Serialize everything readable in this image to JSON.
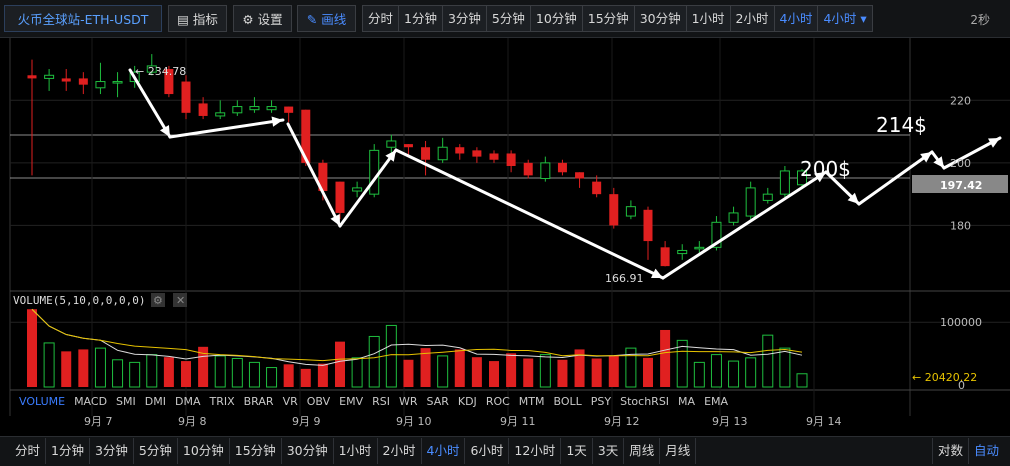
{
  "toolbar": {
    "symbol": "火币全球站-ETH-USDT",
    "indicators_label": "指标",
    "settings_label": "设置",
    "draw_label": "画线",
    "periods": [
      "分时",
      "1分钟",
      "3分钟",
      "5分钟",
      "10分钟",
      "15分钟",
      "30分钟",
      "1小时",
      "2小时",
      "4小时",
      "4小时"
    ],
    "active_period": 9,
    "refresh": "2秒"
  },
  "price_axis": {
    "ticks": [
      "220",
      "200",
      "180"
    ],
    "current_price": "197.42",
    "high_label": "← 234.78",
    "low_label": "166.91"
  },
  "annotations": {
    "label_200": "200$",
    "label_214": "214$"
  },
  "volume": {
    "title": "VOLUME(5,10,0,0,0,0)",
    "axis_tick": "100000",
    "axis_zero": "0",
    "current": "← 20420.22"
  },
  "indicator_tabs": [
    "VOLUME",
    "MACD",
    "SMI",
    "DMI",
    "DMA",
    "TRIX",
    "BRAR",
    "VR",
    "OBV",
    "EMV",
    "RSI",
    "WR",
    "SAR",
    "KDJ",
    "ROC",
    "MTM",
    "BOLL",
    "PSY",
    "StochRSI",
    "MA",
    "EMA"
  ],
  "dates": [
    "9月 7",
    "9月 8",
    "9月 9",
    "9月 10",
    "9月 11",
    "9月 12",
    "9月 13",
    "9月 14"
  ],
  "bottom_periods": [
    "分时",
    "1分钟",
    "3分钟",
    "5分钟",
    "10分钟",
    "15分钟",
    "30分钟",
    "1小时",
    "2小时",
    "4小时",
    "6小时",
    "12小时",
    "1天",
    "3天",
    "周线",
    "月线"
  ],
  "bottom_active": 9,
  "scale": {
    "log": "对数",
    "auto": "自动"
  },
  "colors": {
    "up": "#1fbf3f",
    "down": "#e02020",
    "accent": "#4a8cff"
  },
  "chart_data": {
    "type": "candlestick",
    "ylim": [
      160,
      238
    ],
    "candles": [
      [
        228,
        227,
        233,
        196
      ],
      [
        227,
        228,
        230,
        223
      ],
      [
        227,
        226,
        230,
        223
      ],
      [
        227,
        225,
        229,
        222
      ],
      [
        224,
        226,
        232,
        222
      ],
      [
        226,
        226,
        229,
        221
      ],
      [
        226,
        229,
        231,
        224
      ],
      [
        229,
        231,
        234.78,
        228
      ],
      [
        230,
        222,
        231,
        221
      ],
      [
        226,
        216,
        228,
        214
      ],
      [
        219,
        215,
        221,
        214
      ],
      [
        215,
        216,
        220,
        214
      ],
      [
        216,
        218,
        220,
        215
      ],
      [
        217,
        218,
        221,
        216
      ],
      [
        217,
        218,
        220,
        216
      ],
      [
        218,
        216,
        218,
        213
      ],
      [
        217,
        200,
        217,
        199
      ],
      [
        200,
        191,
        201,
        188
      ],
      [
        194,
        184,
        194,
        182
      ],
      [
        191,
        192,
        194,
        189
      ],
      [
        190,
        204,
        206,
        189
      ],
      [
        205,
        207,
        209,
        203
      ],
      [
        206,
        205,
        206,
        202
      ],
      [
        205,
        201,
        207,
        196
      ],
      [
        201,
        205,
        208,
        200
      ],
      [
        205,
        203,
        206,
        201
      ],
      [
        204,
        202,
        205,
        200
      ],
      [
        203,
        201,
        204,
        200
      ],
      [
        203,
        199,
        204,
        197
      ],
      [
        200,
        196,
        201,
        195
      ],
      [
        195,
        200,
        202,
        194
      ],
      [
        200,
        197,
        201,
        196
      ],
      [
        197,
        195,
        197,
        192
      ],
      [
        194,
        190,
        196,
        189
      ],
      [
        190,
        180,
        192,
        179
      ],
      [
        183,
        186,
        188,
        182
      ],
      [
        185,
        175,
        186,
        169
      ],
      [
        173,
        167,
        175,
        166.91
      ],
      [
        171,
        172,
        174,
        169
      ],
      [
        173,
        173,
        175,
        171
      ],
      [
        173,
        181,
        183,
        172
      ],
      [
        181,
        184,
        186,
        180
      ],
      [
        183,
        192,
        194,
        182
      ],
      [
        188,
        190,
        192,
        187
      ],
      [
        190,
        197.42,
        199,
        189
      ],
      [
        193,
        197.42,
        198,
        192
      ]
    ],
    "volumes": [
      120000,
      68000,
      55000,
      58000,
      60000,
      42000,
      38000,
      50000,
      46000,
      40000,
      62000,
      48000,
      44000,
      38000,
      30000,
      35000,
      28000,
      36000,
      70000,
      45000,
      78000,
      95000,
      42000,
      60000,
      48000,
      58000,
      46000,
      40000,
      52000,
      44000,
      50000,
      42000,
      58000,
      44000,
      48000,
      60000,
      45000,
      88000,
      72000,
      38000,
      50000,
      40000,
      45000,
      80000,
      60000,
      20420.22
    ],
    "vol_max": 125000
  }
}
